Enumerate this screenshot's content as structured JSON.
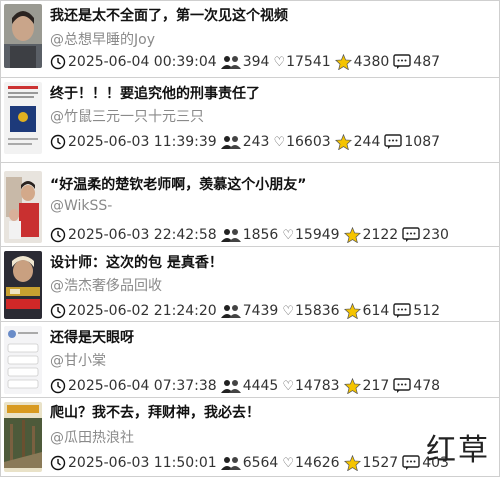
{
  "items": [
    {
      "title": "我还是太不全面了，第一次见这个视频",
      "author": "@总想早睡的Joy",
      "time": "2025-06-04 00:39:04",
      "users": "394",
      "likes": "17541",
      "stars": "4380",
      "comments": "487"
    },
    {
      "title": "终于！！！要追究他的刑事责任了",
      "author": "@竹鼠三元一只十元三只",
      "time": "2025-06-03 11:39:39",
      "users": "243",
      "likes": "16603",
      "stars": "244",
      "comments": "1087"
    },
    {
      "title": "“好温柔的楚钦老师啊，羡慕这个小朋友”",
      "author": "@WikSS-",
      "time": "2025-06-03 22:42:58",
      "users": "1856",
      "likes": "15949",
      "stars": "2122",
      "comments": "230"
    },
    {
      "title": "设计师：这次的包 是真香！",
      "author": "@浩杰奢侈品回收",
      "time": "2025-06-02 21:24:20",
      "users": "7439",
      "likes": "15836",
      "stars": "614",
      "comments": "512"
    },
    {
      "title": "还得是天眼呀",
      "author": "@甘小棠",
      "time": "2025-06-04 07:37:38",
      "users": "4445",
      "likes": "14783",
      "stars": "217",
      "comments": "478"
    },
    {
      "title": "爬山？我不去，拜财神，我必去！",
      "author": "@瓜田热浪社",
      "time": "2025-06-03 11:50:01",
      "users": "6564",
      "likes": "14626",
      "stars": "1527",
      "comments": "403"
    }
  ],
  "watermark": "红草",
  "colors": {
    "star": "#f5c400",
    "text": "#111111",
    "muted": "#8a8a8a"
  },
  "icons": {
    "time": "clock-icon",
    "users": "users-icon",
    "likes": "heart-icon",
    "stars": "star-icon",
    "comments": "comment-icon"
  }
}
